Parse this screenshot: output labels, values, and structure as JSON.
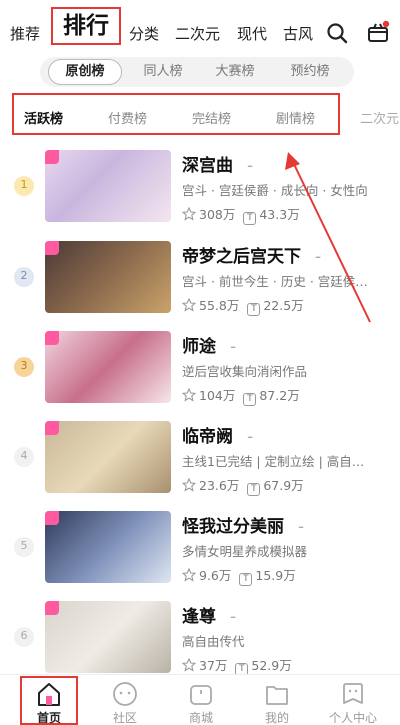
{
  "topnav": {
    "items": [
      "推荐",
      "排行",
      "分类",
      "二次元",
      "现代",
      "古风"
    ],
    "active": "排行"
  },
  "pills": {
    "items": [
      "原创榜",
      "同人榜",
      "大赛榜",
      "预约榜"
    ],
    "active": "原创榜"
  },
  "cattabs": {
    "items": [
      "活跃榜",
      "付费榜",
      "完结榜",
      "剧情榜",
      "二次元"
    ],
    "active": "活跃榜"
  },
  "colors": {
    "accent": "#e53935",
    "badge_pink": "#ff5aa0",
    "rank1": "#f5c542",
    "rank2": "#b8c6d8",
    "rank3": "#e8a33a"
  },
  "list": [
    {
      "rank": "1",
      "title": "深宫曲",
      "tags": "宫斗 · 宫廷侯爵 · 成长向 · 女性向",
      "likes": "308万",
      "reads": "43.3万"
    },
    {
      "rank": "2",
      "title": "帝梦之后宫天下",
      "tags": "宫斗 · 前世今生 · 历史 · 宫廷侯…",
      "likes": "55.8万",
      "reads": "22.5万"
    },
    {
      "rank": "3",
      "title": "师途",
      "tags": "逆后宫收集向消闲作品",
      "likes": "104万",
      "reads": "87.2万"
    },
    {
      "rank": "4",
      "title": "临帝阙",
      "tags": "主线1已完结 | 定制立绘 | 高自…",
      "likes": "23.6万",
      "reads": "67.9万"
    },
    {
      "rank": "5",
      "title": "怪我过分美丽",
      "tags": "多情女明星养成模拟器",
      "likes": "9.6万",
      "reads": "15.9万"
    },
    {
      "rank": "6",
      "title": "逢尊",
      "tags": "高自由传代",
      "likes": "37万",
      "reads": "52.9万"
    }
  ],
  "bottombar": {
    "tabs": [
      "首页",
      "社区",
      "商城",
      "我的",
      "个人中心"
    ],
    "active": "首页"
  },
  "icons": {
    "search": "search-icon",
    "gift": "gift-icon",
    "star": "star-icon",
    "t": "ticket-icon"
  }
}
